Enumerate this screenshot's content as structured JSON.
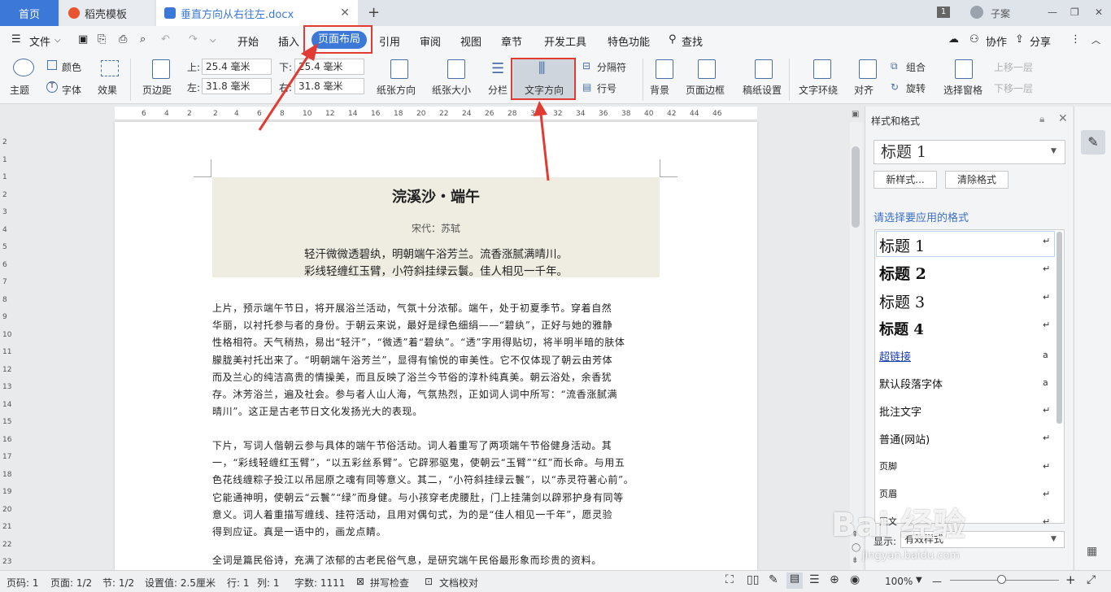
{
  "titlebar": {
    "tabs": [
      {
        "label": "首页"
      },
      {
        "label": "稻壳模板"
      },
      {
        "label": "垂直方向从右往左.docx"
      }
    ],
    "new_tab": "+",
    "badge": "1",
    "user": "子案",
    "win_min": "—",
    "win_max": "❐",
    "win_close": "✕"
  },
  "menubar": {
    "file": "文件",
    "items": [
      "开始",
      "插入",
      "页面布局",
      "引用",
      "审阅",
      "视图",
      "章节",
      "开发工具",
      "特色功能"
    ],
    "search": "查找",
    "collab": "协作",
    "share": "分享"
  },
  "ribbon": {
    "theme": "主题",
    "color": "颜色",
    "font": "字体",
    "effect": "效果",
    "margin": "页边距",
    "top_lbl": "上:",
    "top_val": "25.4 毫米",
    "bottom_lbl": "下:",
    "bottom_val": "25.4 毫米",
    "left_lbl": "左:",
    "left_val": "31.8 毫米",
    "right_lbl": "右:",
    "right_val": "31.8 毫米",
    "orientation": "纸张方向",
    "size": "纸张大小",
    "columns": "分栏",
    "text_direction": "文字方向",
    "separator": "分隔符",
    "line_num": "行号",
    "background": "背景",
    "page_border": "页面边框",
    "grid_paper": "稿纸设置",
    "wrap": "文字环绕",
    "align": "对齐",
    "group": "组合",
    "rotate": "旋转",
    "selection_pane": "选择窗格",
    "bring_forward": "上移一层",
    "send_backward": "下移一层"
  },
  "ruler": {
    "ticks": [
      "6",
      "4",
      "2",
      "2",
      "4",
      "6",
      "8",
      "10",
      "12",
      "14",
      "16",
      "18",
      "20",
      "22",
      "24",
      "26",
      "28",
      "30",
      "32",
      "34",
      "36",
      "38",
      "40",
      "42",
      "44",
      "46"
    ]
  },
  "ruler_left": {
    "ticks": [
      "2",
      "1",
      "1",
      "2",
      "3",
      "4",
      "5",
      "6",
      "7",
      "8",
      "9",
      "10",
      "11",
      "12",
      "13",
      "14",
      "15",
      "16",
      "17",
      "18",
      "19",
      "20",
      "21",
      "22",
      "23"
    ]
  },
  "document": {
    "title": "浣溪沙・端午",
    "author": "宋代：苏轼",
    "poem": [
      "轻汗微微透碧纨，明朝端午浴芳兰。流香涨腻满晴川。",
      "彩线轻缠红玉臂，小符斜挂绿云鬟。佳人相见一千年。"
    ],
    "para1": [
      "上片，预示端午节日，将开展浴兰活动，气氛十分浓郁。端午，处于初夏季节。穿着自然",
      "华丽，以衬托参与者的身份。于朝云来说，最好是绿色细绢——“碧纨”，正好与她的雅静",
      "性格相符。天气稍热，易出“轻汗”，“微透”着“碧纨”。“透”字用得贴切，将半明半暗的肤体",
      "朦胧美衬托出来了。“明朝端午浴芳兰”，显得有愉悦的审美性。它不仅体现了朝云由芳体",
      "而及兰心的纯洁高贵的情操美，而且反映了浴兰今节俗的淳朴纯真美。朝云浴处，余香犹",
      "存。沐芳浴兰，遍及社会。参与者人山人海，气氛热烈，正如词人词中所写：“流香涨腻满",
      "晴川”。这正是古老节日文化发扬光大的表现。"
    ],
    "para2": [
      "下片，写词人偕朝云参与具体的端午节俗活动。词人着重写了两项端午节俗健身活动。其",
      "一，“彩线轻缠红玉臂”，“以五彩丝系臂”。它辟邪驱鬼，使朝云“玉臂”“红”而长命。与用五",
      "色花线缠粽子投江以吊屈原之魂有同等意义。其二，“小符斜挂绿云鬟”，以“赤灵符著心前”。",
      "它能通神明，使朝云“云鬟”“绿”而身健。与小孩穿老虎腰肚，门上挂蒲剑以辟邪护身有同等",
      "意义。词人着重描写缠线、挂符活动，且用对偶句式，为的是“佳人相见一千年”，愿灵验",
      "得到应证。真是一语中的，画龙点睛。"
    ],
    "para3": [
      "全词是篇民俗诗，充满了浓郁的古老民俗气息，是研究端午民俗最形象而珍贵的资料。"
    ]
  },
  "pane": {
    "title": "样式和格式",
    "current": "标题  1",
    "new_style": "新样式...",
    "clear": "清除格式",
    "apply_label": "请选择要应用的格式",
    "styles": [
      {
        "label": "标题  1",
        "mark": "↵"
      },
      {
        "label": "标题  2",
        "mark": "↵"
      },
      {
        "label": "标题  3",
        "mark": "↵"
      },
      {
        "label": "标题  4",
        "mark": "↵"
      },
      {
        "label": "超链接",
        "mark": "a"
      },
      {
        "label": "默认段落字体",
        "mark": "a"
      },
      {
        "label": "批注文字",
        "mark": "↵"
      },
      {
        "label": "普通(网站)",
        "mark": "↵"
      },
      {
        "label": "页脚",
        "mark": "↵"
      },
      {
        "label": "页眉",
        "mark": "↵"
      },
      {
        "label": "正文",
        "mark": "↵"
      }
    ],
    "show_label": "显示:",
    "show_value": "有效样式"
  },
  "status": {
    "page_num": "页码: 1",
    "page": "页面: 1/2",
    "section": "节: 1/2",
    "setting": "设置值: 2.5厘米",
    "row": "行: 1",
    "col": "列: 1",
    "words": "字数: 1111",
    "spell": "拼写检查",
    "proof": "文档校对",
    "zoom": "100%"
  },
  "watermark": {
    "brand": "Bai  经验",
    "url": "jingyan.baidu.com"
  },
  "colors": {
    "accent": "#3b78d8",
    "annotation": "#e23b33",
    "title_bg": "#efede2"
  }
}
